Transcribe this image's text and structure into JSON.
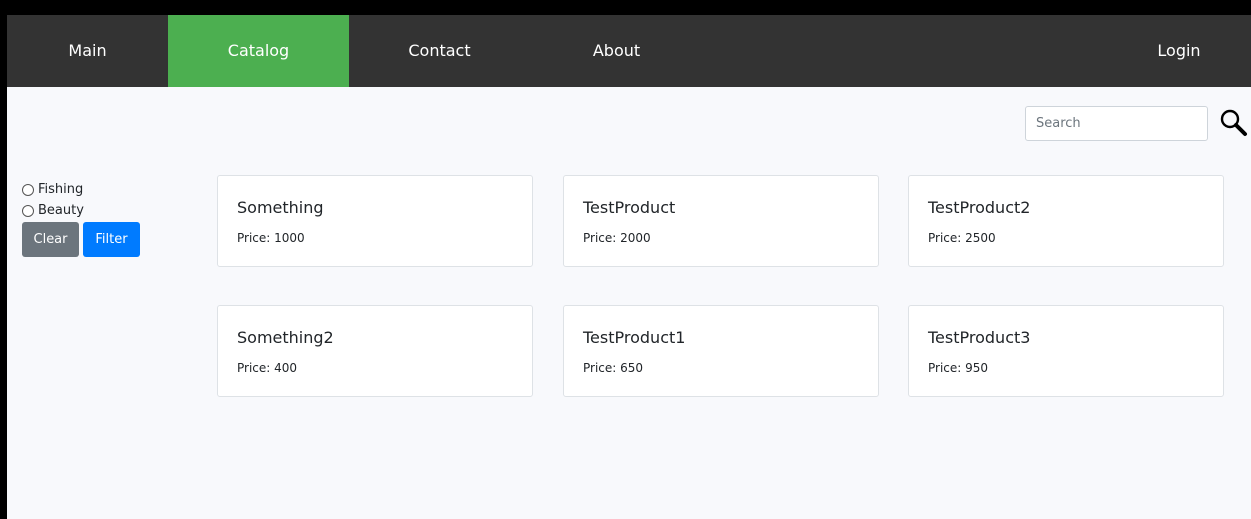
{
  "nav": {
    "items": [
      {
        "label": "Main"
      },
      {
        "label": "Catalog"
      },
      {
        "label": "Contact"
      },
      {
        "label": "About"
      }
    ],
    "login": "Login",
    "active_color": "#4caf50",
    "bg_color": "#333333"
  },
  "search": {
    "placeholder": "Search",
    "icon": "search-icon"
  },
  "filters": {
    "options": [
      {
        "label": "Fishing"
      },
      {
        "label": "Beauty"
      }
    ],
    "clear_label": "Clear",
    "filter_label": "Filter"
  },
  "products": [
    {
      "name": "Something",
      "price": "Price: 1000"
    },
    {
      "name": "TestProduct",
      "price": "Price: 2000"
    },
    {
      "name": "TestProduct2",
      "price": "Price: 2500"
    },
    {
      "name": "Something2",
      "price": "Price: 400"
    },
    {
      "name": "TestProduct1",
      "price": "Price: 650"
    },
    {
      "name": "TestProduct3",
      "price": "Price: 950"
    }
  ]
}
